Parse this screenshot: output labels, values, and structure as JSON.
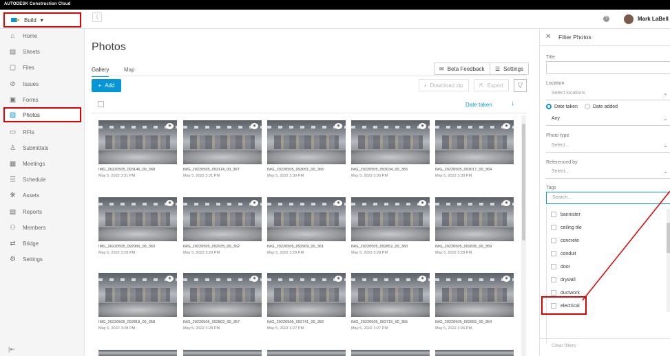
{
  "topbar": {
    "brand": "AUTODESK Construction Cloud"
  },
  "header": {
    "product_label": "Build",
    "product_caret": "▾",
    "toggle_glyph": "⟨",
    "help_glyph": "?",
    "user_name": "Mark LaBell"
  },
  "sidebar": {
    "items": [
      {
        "label": "Home",
        "icon": "home-icon",
        "glyph": "⌂"
      },
      {
        "label": "Sheets",
        "icon": "sheets-icon",
        "glyph": "▤"
      },
      {
        "label": "Files",
        "icon": "files-icon",
        "glyph": "▢"
      },
      {
        "label": "Issues",
        "icon": "issues-icon",
        "glyph": "⊘"
      },
      {
        "label": "Forms",
        "icon": "forms-icon",
        "glyph": "▣"
      },
      {
        "label": "Photos",
        "icon": "photos-icon",
        "glyph": "▨"
      },
      {
        "label": "RFIs",
        "icon": "rfis-icon",
        "glyph": "▭"
      },
      {
        "label": "Submittals",
        "icon": "submittals-icon",
        "glyph": "♙"
      },
      {
        "label": "Meetings",
        "icon": "meetings-icon",
        "glyph": "▦"
      },
      {
        "label": "Schedule",
        "icon": "schedule-icon",
        "glyph": "☰"
      },
      {
        "label": "Assets",
        "icon": "assets-icon",
        "glyph": "❋"
      },
      {
        "label": "Reports",
        "icon": "reports-icon",
        "glyph": "▤"
      },
      {
        "label": "Members",
        "icon": "members-icon",
        "glyph": "⚇"
      },
      {
        "label": "Bridge",
        "icon": "bridge-icon",
        "glyph": "⇄"
      },
      {
        "label": "Settings",
        "icon": "settings-icon",
        "glyph": "⚙"
      }
    ],
    "active_label": "Photos",
    "collapse_glyph": "|⇤"
  },
  "main": {
    "title": "Photos",
    "tabs": [
      "Gallery",
      "Map"
    ],
    "active_tab": "Gallery",
    "buttons": {
      "beta_feedback": "Beta Feedback",
      "settings": "Settings",
      "add": "Add",
      "download": "Download zip",
      "export": "Export"
    },
    "sort_label": "Date taken",
    "sort_glyph": "↓"
  },
  "photos": [
    {
      "name": "IMG_20220505_093146_00_368",
      "date": "May 5, 2022 3:31 PM"
    },
    {
      "name": "IMG_20220505_093114_00_367",
      "date": "May 5, 2022 3:31 PM"
    },
    {
      "name": "IMG_20220505_093051_00_366",
      "date": "May 5, 2022 3:30 PM"
    },
    {
      "name": "IMG_20220505_093034_00_365",
      "date": "May 5, 2022 3:30 PM"
    },
    {
      "name": "IMG_20220505_093017_00_364",
      "date": "May 5, 2022 3:30 PM"
    },
    {
      "name": "IMG_20220505_092956_00_363",
      "date": "May 5, 2022 3:29 PM"
    },
    {
      "name": "IMG_20220505_092935_00_362",
      "date": "May 5, 2022 3:29 PM"
    },
    {
      "name": "IMG_20220505_092909_00_361",
      "date": "May 5, 2022 3:29 PM"
    },
    {
      "name": "IMG_20220505_092852_00_360",
      "date": "May 5, 2022 3:28 PM"
    },
    {
      "name": "IMG_20220505_092836_00_359",
      "date": "May 5, 2022 3:28 PM"
    },
    {
      "name": "IMG_20220505_092818_00_358",
      "date": "May 5, 2022 3:28 PM"
    },
    {
      "name": "IMG_20220505_092802_00_357",
      "date": "May 5, 2022 3:28 PM"
    },
    {
      "name": "IMG_20220505_092741_00_356",
      "date": "May 5, 2022 3:27 PM"
    },
    {
      "name": "IMG_20220505_092715_00_355",
      "date": "May 5, 2022 3:27 PM"
    },
    {
      "name": "IMG_20220505_092655_00_354",
      "date": "May 5, 2022 3:26 PM"
    }
  ],
  "filter_panel": {
    "title": "Filter Photos",
    "title_label": "Title",
    "location_label": "Location",
    "location_placeholder": "Select locations",
    "radio_date_taken": "Date taken",
    "radio_date_added": "Date added",
    "date_value": "Any",
    "photo_type_label": "Photo type",
    "photo_type_placeholder": "Select...",
    "referenced_by_label": "Referenced by",
    "referenced_by_placeholder": "Select...",
    "tags_label": "Tags",
    "tags_placeholder": "Search...",
    "tags": [
      "bannister",
      "ceiling tile",
      "concrete",
      "conduit",
      "door",
      "drywall",
      "ductwork",
      "electrical"
    ],
    "clear_filters": "Clear filters",
    "chevron": "⌄"
  },
  "colors": {
    "accent": "#0696d7",
    "annotation": "#e00000"
  }
}
